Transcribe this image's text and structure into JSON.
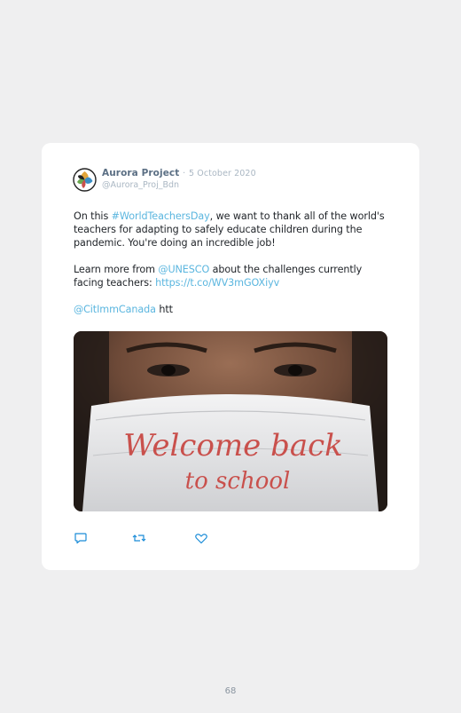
{
  "tweet": {
    "author_name": "Aurora Project",
    "separator": "·",
    "date": "5 October 2020",
    "handle": "@Aurora_Proj_Bdn",
    "p1_before": "On this ",
    "p1_hashtag": "#WorldTeachersDay",
    "p1_after": ", we want to thank all of the world's teachers for adapting to safely educate children during the pandemic. You're doing an incredible job!",
    "p2_before": "Learn more from ",
    "p2_mention": "@UNESCO",
    "p2_middle": " about the challenges currently facing teachers: ",
    "p2_link": "https://t.co/WV3mGOXiyv",
    "p3_mention": "@CitImmCanada",
    "p3_after": " htt",
    "image_text_line1": "Welcome back",
    "image_text_line2": "to school"
  },
  "actions": {
    "reply_icon": "reply-icon",
    "retweet_icon": "retweet-icon",
    "like_icon": "heart-icon"
  },
  "page": {
    "number": "68"
  },
  "colors": {
    "link": "#5bb6df",
    "mask_text": "#c9504c"
  }
}
